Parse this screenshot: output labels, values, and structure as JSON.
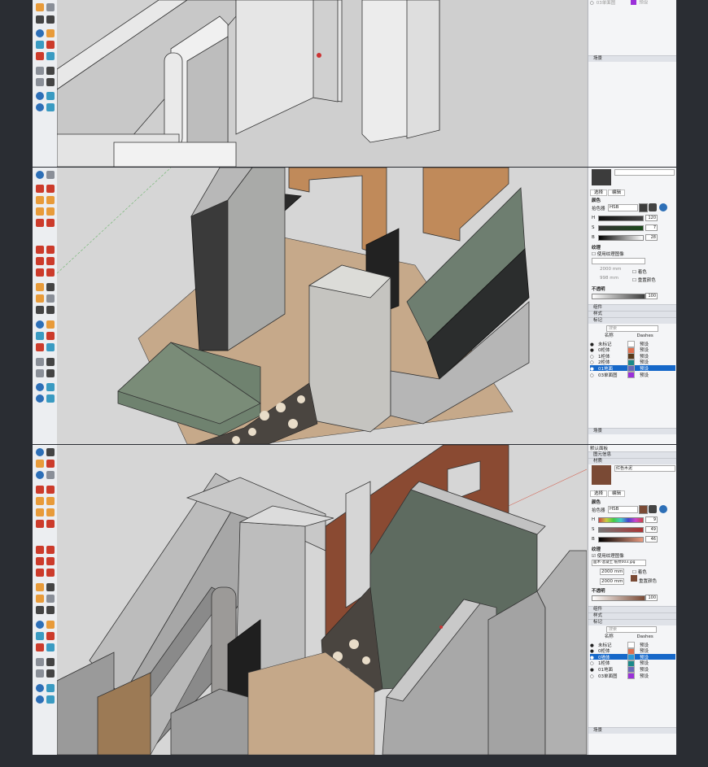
{
  "panel1": {
    "tags": {
      "rows": [
        {
          "name": "03单面图",
          "dash": "预设",
          "color": "#9b30d9"
        }
      ]
    },
    "scene_section": "场景"
  },
  "panel2": {
    "material_name": "",
    "material_tabs": [
      "选择",
      "编辑"
    ],
    "color_label": "颜色",
    "picker_label": "拾色器",
    "picker_mode": "HSB",
    "h_label": "H",
    "h_value": "120",
    "s_label": "S",
    "s_value": "7",
    "b_label": "B",
    "b_value": "28",
    "texture_label": "纹理",
    "use_texture": "使用纹理图像",
    "width_mm": "2000 mm",
    "height_mm": "998 mm",
    "colorize": "着色",
    "reset_color": "重置颜色",
    "opacity_label": "不透明",
    "opacity_value": "100",
    "sections": [
      "组件",
      "样式",
      "标记"
    ],
    "search_placeholder": "搜索",
    "col_name": "名称",
    "col_dash": "Dashes",
    "tags": [
      {
        "name": "未标记",
        "dash": "预设",
        "color": "#ffffff",
        "eye": "●"
      },
      {
        "name": "0柜体",
        "dash": "预设",
        "color": "#e07050",
        "eye": "●"
      },
      {
        "name": "1柜体",
        "dash": "预设",
        "color": "#5a3a1a",
        "eye": "○"
      },
      {
        "name": "2柜体",
        "dash": "预设",
        "color": "#1a8a8a",
        "eye": "○"
      },
      {
        "name": "01地面",
        "dash": "预设",
        "color": "#6a6ab8",
        "eye": "●"
      },
      {
        "name": "03单面图",
        "dash": "预设",
        "color": "#9b30d9",
        "eye": "○"
      }
    ],
    "selected_tag_index": 4,
    "scene_section": "场景"
  },
  "panel3": {
    "tray_title": "默认面板",
    "sections_top": [
      "图元信息",
      "材质"
    ],
    "material_name": "红色木泥",
    "material_tabs": [
      "选择",
      "编辑"
    ],
    "color_label": "颜色",
    "picker_label": "拾色器",
    "picker_mode": "HSB",
    "h_label": "H",
    "h_value": "9",
    "s_label": "S",
    "s_value": "49",
    "b_label": "B",
    "b_value": "46",
    "texture_label": "纹理",
    "use_texture": "使用纹理图像",
    "texture_file": "面木-混凝土 纸纹003.jpg",
    "width_mm": "2000 mm",
    "height_mm": "2000 mm",
    "colorize": "着色",
    "reset_color": "重置颜色",
    "opacity_label": "不透明",
    "opacity_value": "100",
    "sections": [
      "组件",
      "样式",
      "标记"
    ],
    "search_placeholder": "搜索",
    "col_name": "名称",
    "col_dash": "Dashes",
    "tags": [
      {
        "name": "未标记",
        "dash": "预设",
        "color": "#ffffff",
        "eye": "●"
      },
      {
        "name": "0柜体",
        "dash": "预设",
        "color": "#e07050",
        "eye": "●"
      },
      {
        "name": "0墙体",
        "dash": "预设",
        "color": "#2a9ad8",
        "eye": "●"
      },
      {
        "name": "1柜体",
        "dash": "预设",
        "color": "#1a8a8a",
        "eye": "○"
      },
      {
        "name": "01地面",
        "dash": "预设",
        "color": "#6a6ab8",
        "eye": "●"
      },
      {
        "name": "03单面图",
        "dash": "预设",
        "color": "#9b30d9",
        "eye": "○"
      }
    ],
    "selected_tag_index": 2,
    "scene_section": "场景"
  },
  "colors": {
    "chrome": "#2a2d33",
    "panel_bg": "#f4f5f7",
    "selection": "#1668c9",
    "viewport_bg": "#d4d4d4"
  }
}
